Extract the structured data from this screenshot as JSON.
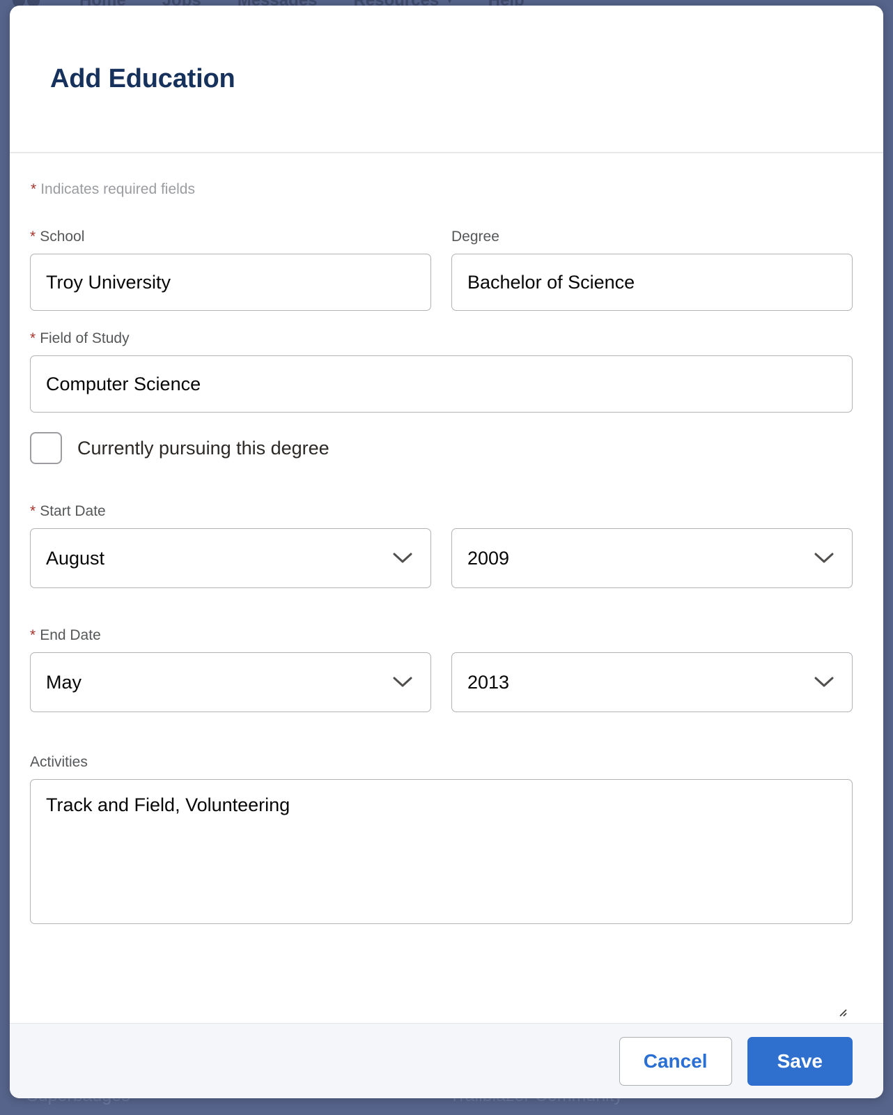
{
  "background": {
    "nav_items": [
      "Home",
      "Jobs",
      "Messages",
      "Resources",
      "Help"
    ],
    "resources_caret": "▾",
    "footer_left": "Superbadges",
    "footer_right": "Trailblazer Community"
  },
  "modal": {
    "title": "Add Education",
    "required_note": "Indicates required fields",
    "required_marker": "*",
    "fields": {
      "school": {
        "label": "School",
        "required": true,
        "value": "Troy University",
        "placeholder": ""
      },
      "degree": {
        "label": "Degree",
        "required": false,
        "value": "Bachelor of Science",
        "placeholder": ""
      },
      "field_of_study": {
        "label": "Field of Study",
        "required": true,
        "value": "Computer Science",
        "placeholder": ""
      },
      "currently_pursuing": {
        "label": "Currently pursuing this degree",
        "checked": false
      },
      "start_date": {
        "label": "Start Date",
        "required": true,
        "month": "August",
        "year": "2009"
      },
      "end_date": {
        "label": "End Date",
        "required": true,
        "month": "May",
        "year": "2013"
      },
      "activities": {
        "label": "Activities",
        "required": false,
        "value": "Track and Field, Volunteering",
        "placeholder": ""
      }
    },
    "footer": {
      "cancel_label": "Cancel",
      "save_label": "Save"
    }
  },
  "colors": {
    "page_background": "#56638a",
    "modal_background": "#ffffff",
    "title": "#16325c",
    "required_star": "#a4342c",
    "label_text": "#555759",
    "input_border": "#b0b2b5",
    "primary_button": "#2f6fce",
    "link_blue": "#2a6fd4",
    "footer_background": "#f4f6f9"
  }
}
